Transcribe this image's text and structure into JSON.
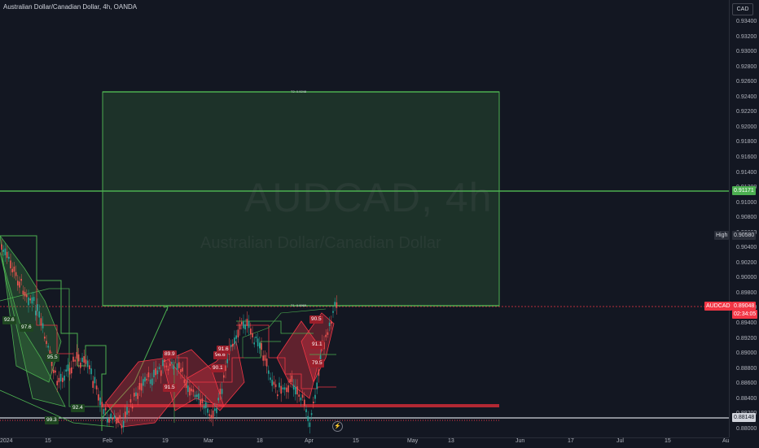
{
  "header": {
    "title": "Australian Dollar/Canadian Dollar, 4h, OANDA"
  },
  "watermark": {
    "symbol": "AUDCAD, 4h",
    "description": "Australian Dollar/Canadian Dollar"
  },
  "currency_button": "CAD",
  "price_axis": {
    "ticks": [
      "0.93400",
      "0.93200",
      "0.93000",
      "0.92800",
      "0.92600",
      "0.92400",
      "0.92200",
      "0.92000",
      "0.91800",
      "0.91600",
      "0.91400",
      "0.91200",
      "0.91000",
      "0.90800",
      "0.90600",
      "0.90400",
      "0.90200",
      "0.90000",
      "0.89800",
      "0.89600",
      "0.89400",
      "0.89200",
      "0.89000",
      "0.88800",
      "0.88600",
      "0.88400",
      "0.88200",
      "0.88000"
    ],
    "labels": {
      "green_line": "0.91171",
      "high_text": "High",
      "high_value": "0.90580",
      "symbol": "AUDCAD",
      "last_price": "0.89048",
      "countdown": "02:34:05",
      "bottom_line": "0.88148"
    }
  },
  "time_axis": {
    "ticks": [
      "2024",
      "15",
      "Feb",
      "19",
      "Mar",
      "18",
      "Apr",
      "15",
      "May",
      "13",
      "Jun",
      "17",
      "Jul",
      "15",
      "Au"
    ]
  },
  "position_box": {
    "target_label": "T2: 0.9248",
    "entry_label": "T1: 0.8965"
  },
  "pattern_labels": [
    {
      "text": "92.6"
    },
    {
      "text": "97.6"
    },
    {
      "text": "95.5"
    },
    {
      "text": "92.4"
    },
    {
      "text": "99.3"
    },
    {
      "text": "89.9"
    },
    {
      "text": "91.5"
    },
    {
      "text": "96.6"
    },
    {
      "text": "90.1"
    },
    {
      "text": "91.6"
    },
    {
      "text": "90.5"
    },
    {
      "text": "91.1"
    },
    {
      "text": "79.5"
    }
  ],
  "colors": {
    "background": "#131722",
    "green": "#4caf50",
    "red": "#f23645",
    "axis_text": "#b2b5be"
  }
}
